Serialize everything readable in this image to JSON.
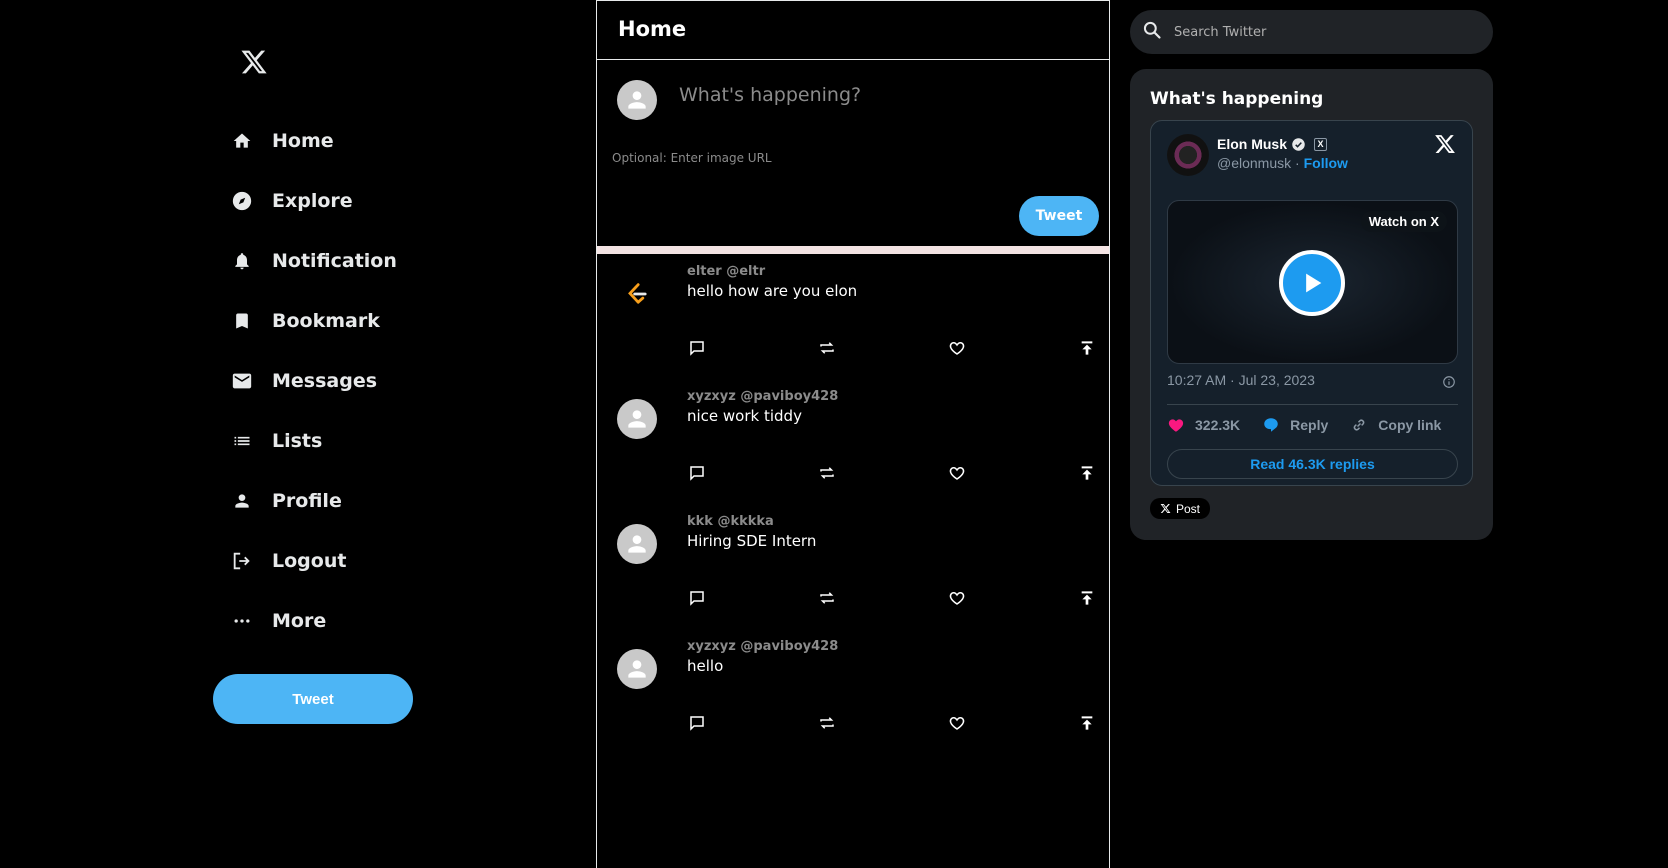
{
  "sidebar": {
    "logo": "x-logo-icon",
    "items": [
      {
        "label": "Home",
        "icon": "home-icon"
      },
      {
        "label": "Explore",
        "icon": "explore-icon"
      },
      {
        "label": "Notification",
        "icon": "bell-icon"
      },
      {
        "label": "Bookmark",
        "icon": "bookmark-icon"
      },
      {
        "label": "Messages",
        "icon": "mail-icon"
      },
      {
        "label": "Lists",
        "icon": "list-icon"
      },
      {
        "label": "Profile",
        "icon": "person-icon"
      },
      {
        "label": "Logout",
        "icon": "logout-icon"
      },
      {
        "label": "More",
        "icon": "more-icon"
      }
    ],
    "tweet_button": "Tweet"
  },
  "main": {
    "title": "Home",
    "composer": {
      "placeholder": "What's happening?",
      "image_url_placeholder": "Optional: Enter image URL",
      "tweet_button": "Tweet"
    },
    "posts": [
      {
        "author": "elter @eltr",
        "text": "hello how are you elon",
        "avatar": "leetcode-logo"
      },
      {
        "author": "xyzxyz @paviboy428",
        "text": "nice work tiddy",
        "avatar": "default-avatar"
      },
      {
        "author": "kkk @kkkka",
        "text": "Hiring SDE Intern",
        "avatar": "default-avatar"
      },
      {
        "author": "xyzxyz @paviboy428",
        "text": "hello",
        "avatar": "default-avatar"
      }
    ]
  },
  "right": {
    "search_placeholder": "Search Twitter",
    "happening_title": "What's happening",
    "embed": {
      "name": "Elon Musk",
      "handle": "@elonmusk",
      "separator": " · ",
      "follow": "Follow",
      "watch": "Watch on X",
      "timestamp": "10:27 AM · Jul 23, 2023",
      "likes": "322.3K",
      "reply": "Reply",
      "copy_link": "Copy link",
      "read_replies": "Read 46.3K replies",
      "badge": "X"
    },
    "x_post_label": "Post"
  },
  "colors": {
    "accent": "#4db5f5",
    "link": "#1d9bf0",
    "like": "#f91880",
    "panel": "#202327",
    "divider": "#f3e3e3"
  }
}
